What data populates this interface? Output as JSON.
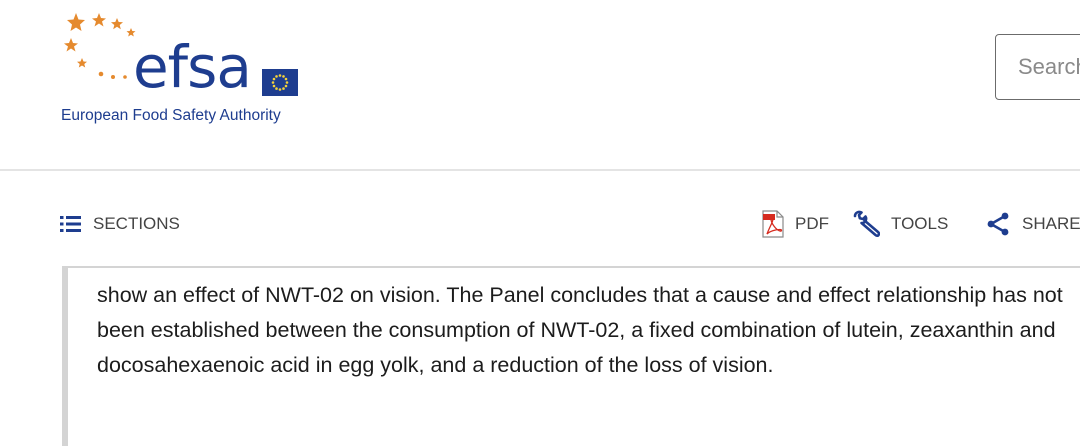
{
  "header": {
    "logo": {
      "wordmark": "efsa",
      "tagline": "European Food Safety Authority"
    },
    "search": {
      "placeholder": "Search"
    }
  },
  "toolbar": {
    "sections_label": "SECTIONS",
    "pdf_label": "PDF",
    "tools_label": "TOOLS",
    "share_label": "SHARE"
  },
  "article": {
    "text": "show an effect of NWT-02 on vision. The Panel concludes that a cause and effect relationship has not been established between the consumption of NWT-02, a fixed combination of lutein, zeaxanthin and docosahexaenoic acid in egg yolk, and a reduction of the loss of vision."
  },
  "colors": {
    "brand_blue": "#1e3d8f",
    "star_orange": "#e58a2e",
    "toolbar_text": "#444444",
    "quote_border": "#d4d4d4"
  }
}
